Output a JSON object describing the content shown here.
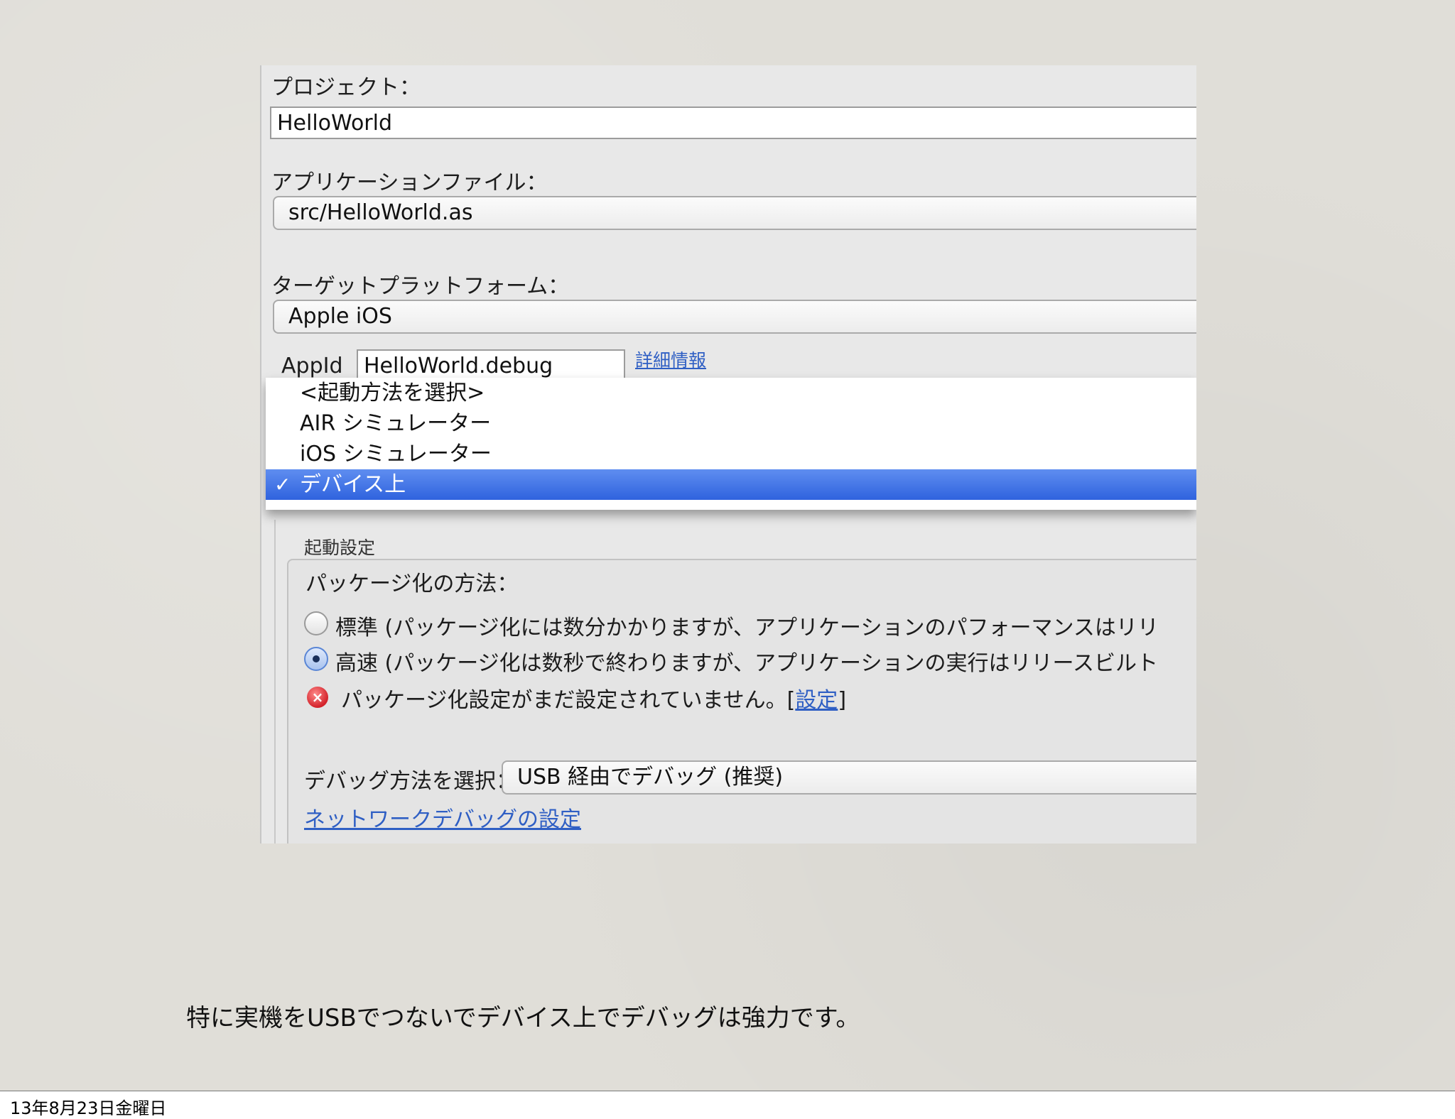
{
  "form": {
    "project_label": "プロジェクト：",
    "project_value": "HelloWorld",
    "app_file_label": "アプリケーションファイル：",
    "app_file_value": "src/HelloWorld.as",
    "target_platform_label": "ターゲットプラットフォーム：",
    "target_platform_value": "Apple iOS",
    "appid_label": "AppId",
    "appid_value": "HelloWorld.debug",
    "details_link": "詳細情報"
  },
  "launch_menu": {
    "items": [
      {
        "label": "<起動方法を選択>",
        "selected": false
      },
      {
        "label": "AIR シミュレーター",
        "selected": false
      },
      {
        "label": "iOS シミュレーター",
        "selected": false
      },
      {
        "label": "デバイス上",
        "selected": true
      }
    ],
    "check_mark": "✓"
  },
  "launch_settings": {
    "group_title": "起動設定",
    "packaging_label": "パッケージ化の方法：",
    "option_standard": "標準 (パッケージ化には数分かかりますが、アプリケーションのパフォーマンスはリリ",
    "option_fast": "高速 (パッケージ化は数秒で終わりますが、アプリケーションの実行はリリースビルト",
    "selected_option": "fast",
    "error_text": "パッケージ化設定がまだ設定されていません。[",
    "error_link": "設定",
    "error_close": "]",
    "debug_method_label": "デバッグ方法を選択：",
    "debug_method_value": "USB 経由でデバッグ (推奨)",
    "network_debug_link": "ネットワークデバッグの設定"
  },
  "caption": "特に実機をUSBでつないでデバイス上でデバッグは強力です。",
  "footer": "13年8月23日金曜日",
  "colors": {
    "selection": "#3a6fe0",
    "link": "#2f5fc4",
    "error": "#d3222a"
  }
}
